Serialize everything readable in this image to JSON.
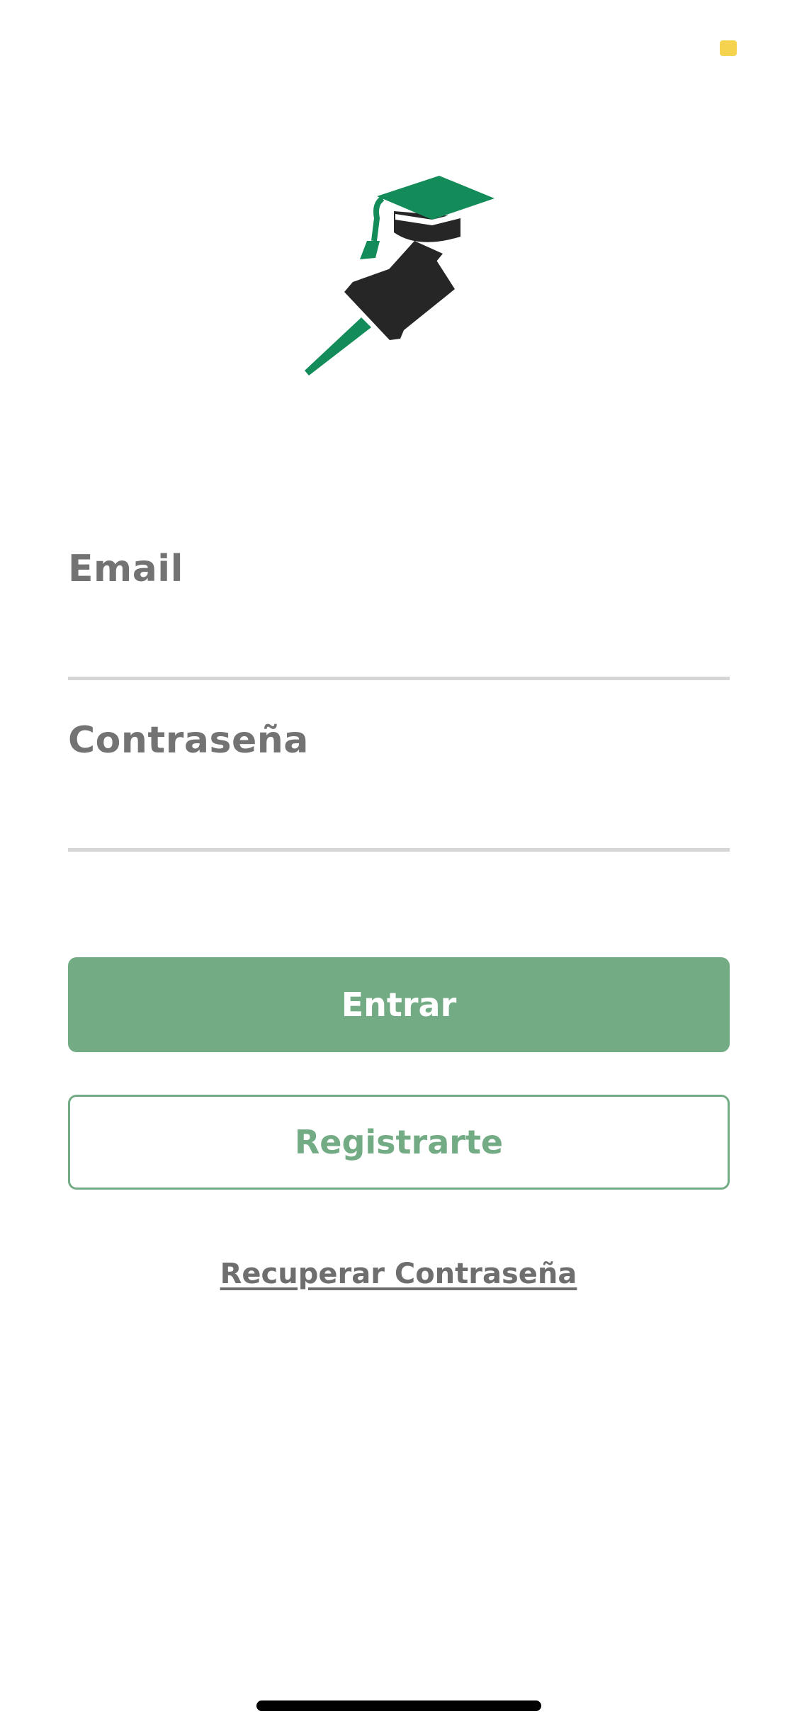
{
  "login": {
    "email_label": "Email",
    "email_value": "",
    "password_label": "Contraseña",
    "password_value": "",
    "login_button": "Entrar",
    "register_button": "Registrarte",
    "recover_link": "Recuperar Contraseña"
  },
  "logo": {
    "icon": "graduation-cap-pushpin-icon",
    "accent_color": "#148c5a",
    "dark_color": "#262626"
  },
  "colors": {
    "primary_button": "#73ab84",
    "label": "#737373",
    "status_dot": "#f6d34f"
  }
}
